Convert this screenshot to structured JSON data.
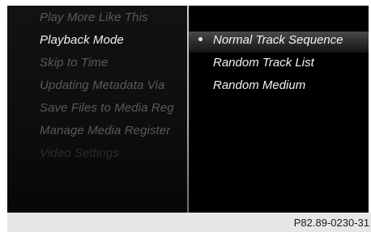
{
  "left_menu": {
    "items": [
      {
        "label": "Play More Like This",
        "state": "dim"
      },
      {
        "label": "Playback Mode",
        "state": "active"
      },
      {
        "label": "Skip to Time",
        "state": "dim"
      },
      {
        "label": "Updating Metadata Via",
        "state": "dim"
      },
      {
        "label": "Save Files to Media Reg",
        "state": "dim"
      },
      {
        "label": "Manage Media Register",
        "state": "dim"
      },
      {
        "label": "Video Settings",
        "state": "faint"
      }
    ]
  },
  "right_menu": {
    "selected_index": 0,
    "options": [
      {
        "label": "Normal Track Sequence"
      },
      {
        "label": "Random Track List"
      },
      {
        "label": "Random Medium"
      }
    ]
  },
  "caption": {
    "text": "P82.89-0230-31"
  },
  "colors": {
    "active_text": "#f2f2f2",
    "dim_text": "#5a5a5a",
    "screen_background": "#000000",
    "caption_background": "#e6e6e6"
  }
}
